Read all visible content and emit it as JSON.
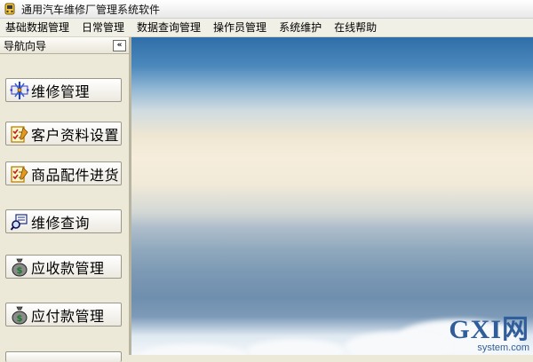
{
  "window": {
    "title": "通用汽车维修厂管理系统软件",
    "icon": "car-app-icon"
  },
  "menu": [
    {
      "label": "基础数据管理"
    },
    {
      "label": "日常管理"
    },
    {
      "label": "数据查询管理"
    },
    {
      "label": "操作员管理"
    },
    {
      "label": "系统维护"
    },
    {
      "label": "在线帮助"
    }
  ],
  "sidebar": {
    "title": "导航向导",
    "collapse_label": "«",
    "items": [
      {
        "label": "维修管理",
        "icon": "repair-tools-icon"
      },
      {
        "label": "客户资料设置",
        "icon": "checklist-icon"
      },
      {
        "label": "商品配件进货",
        "icon": "checklist-icon"
      },
      {
        "label": "维修查询",
        "icon": "search-query-icon"
      },
      {
        "label": "应收款管理",
        "icon": "money-bag-icon"
      },
      {
        "label": "应付款管理",
        "icon": "money-bag-icon"
      }
    ]
  },
  "watermark": {
    "logo": "GXI网",
    "site": "system.com"
  },
  "colors": {
    "menu_bg": "#f1f0e6",
    "sidebar_bg": "#ece9d8",
    "money_green": "#1d7a2c"
  }
}
